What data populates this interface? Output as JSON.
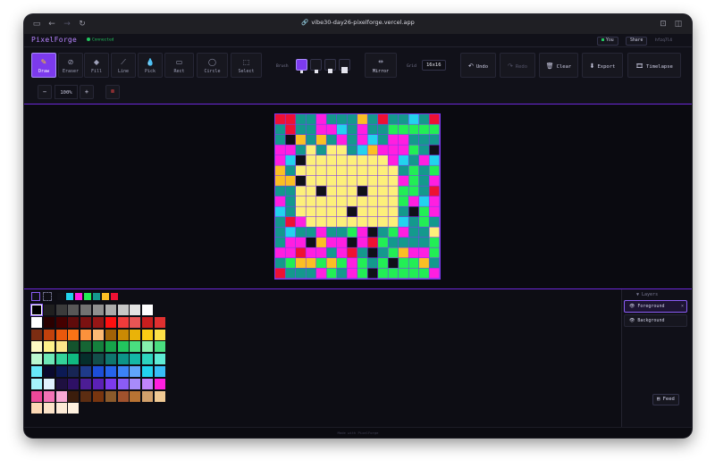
{
  "browser": {
    "url": "vibe30-day26-pixelforge.vercel.app"
  },
  "app": {
    "name": "PixelForge",
    "status": "Connected",
    "you_label": "You",
    "share_label": "Share",
    "session_id": "hfzq7l4",
    "footer": "Made with PixelForge"
  },
  "toolbar": {
    "tools": [
      {
        "label": "Draw",
        "icon": "pencil-icon",
        "glyph": "✎",
        "active": true
      },
      {
        "label": "Eraser",
        "icon": "eraser-icon",
        "glyph": "⊘",
        "active": false
      },
      {
        "label": "Fill",
        "icon": "fill-icon",
        "glyph": "◆",
        "active": false
      },
      {
        "label": "Line",
        "icon": "line-icon",
        "glyph": "⟋",
        "active": false
      },
      {
        "label": "Pick",
        "icon": "eyedropper-icon",
        "glyph": "💧",
        "active": false
      },
      {
        "label": "Rect",
        "icon": "rect-icon",
        "glyph": "▭",
        "active": false
      },
      {
        "label": "Circle",
        "icon": "circle-icon",
        "glyph": "◯",
        "active": false
      },
      {
        "label": "Select",
        "icon": "select-icon",
        "glyph": "⬚",
        "active": false
      }
    ],
    "brush_label": "Brush",
    "mirror_label": "Mirror",
    "grid_label": "Grid",
    "grid_value": "16x16",
    "undo_label": "Undo",
    "redo_label": "Redo",
    "clear_label": "Clear",
    "export_label": "Export",
    "timelapse_label": "Timelapse",
    "zoom_value": "100%",
    "zoom_out": "−",
    "zoom_in": "+"
  },
  "colors": {
    "accent": "#7c3aed",
    "connected": "#22c55e",
    "canvas_bg": "#0a0a10"
  },
  "canvas": {
    "size": 16,
    "pixels": [
      "RRTTMTTTOTRTTCTR",
      "TRTTMMCTMTTGGGGG",
      "TKOTOTMTMCTMMTTT",
      "MMTYTYYTCOMMMGTK",
      "MCKYYYYYYYYMCTMC",
      "OTYYYYYYYYYYTGTG",
      "OOKYYYYYYYYYMGTM",
      "TTYYKYYYKYYYGGTR",
      "MTYYYYYYYYYYGMCM",
      "CTYYYYYKYYYYTKGM",
      "TRMYYYYYYYYYCTGT",
      "TCTTMTTGMKTGMTTY",
      "TMMKOMMKMRGTTTTG",
      "MMRMMTMRTKTGOMMG",
      "TGOOGOGMGTGKGGOT",
      "RTTTMGTMGKGGGGGM"
    ],
    "legend": {
      "R": "#ee1133",
      "T": "#14998d",
      "M": "#ff1fe0",
      "O": "#fbbf24",
      "C": "#22d3ee",
      "G": "#22ee55",
      "K": "#101018",
      "Y": "#fdf07a"
    }
  },
  "palette": {
    "current": [
      "#101018",
      "#22d3ee",
      "#ff1fe0",
      "#22ee55",
      "#14998d",
      "#fbbf24",
      "#ee1133"
    ],
    "rows": [
      [
        "#000000",
        "#1f1f1f",
        "#3b3b3b",
        "#575757",
        "#727272",
        "#8f8f8f",
        "#ababab",
        "#c7c7c7",
        "#e3e3e3",
        "#ffffff"
      ],
      [
        "#ffffff",
        "#2a0000",
        "#450000",
        "#600b0b",
        "#7b1111",
        "#961616",
        "#ff1010",
        "#f03b3b",
        "#e85555",
        "#c81e1e",
        "#e03030"
      ],
      [
        "#7c2d12",
        "#c2410c",
        "#ea580c",
        "#f97316",
        "#fb923c",
        "#fdba74",
        "#a16207",
        "#ca8a04",
        "#eab308",
        "#facc15",
        "#fde047"
      ],
      [
        "#fef9c3",
        "#fef08a",
        "#fde68a",
        "#14532d",
        "#166534",
        "#15803d",
        "#16a34a",
        "#22c55e",
        "#4ade80",
        "#86efac",
        "#4ade80"
      ],
      [
        "#bbf7d0",
        "#6ee7b7",
        "#34d399",
        "#10b981",
        "#052e2b",
        "#134e4a",
        "#0f766e",
        "#0d9488",
        "#14b8a6",
        "#2dd4bf",
        "#5eead4"
      ],
      [
        "#67e8f9",
        "#0a0a2e",
        "#0c1a55",
        "#172554",
        "#1e3a8a",
        "#1d4ed8",
        "#2563eb",
        "#3b82f6",
        "#60a5fa",
        "#22d3ee",
        "#38bdf8"
      ],
      [
        "#a5f3fc",
        "#e0f2fe",
        "#1e1040",
        "#2e1065",
        "#4c1d95",
        "#5b21b6",
        "#7c3aed",
        "#8b5cf6",
        "#a78bfa",
        "#c084fc",
        "#ff1fe0"
      ],
      [
        "#ec4899",
        "#f472b6",
        "#f9a8d4",
        "#3b1d0c",
        "#5c2d12",
        "#78350f",
        "#8b5a2b",
        "#a0522d",
        "#b87333",
        "#d2a06b",
        "#f0c994"
      ],
      [
        "#fdd9b5",
        "#fbe3c9",
        "#fdebd7",
        "#fff1e0"
      ]
    ]
  },
  "layers": {
    "title": "Layers",
    "items": [
      {
        "name": "Foreground",
        "active": true
      },
      {
        "name": "Background",
        "active": false
      }
    ],
    "feed_label": "Feed"
  }
}
